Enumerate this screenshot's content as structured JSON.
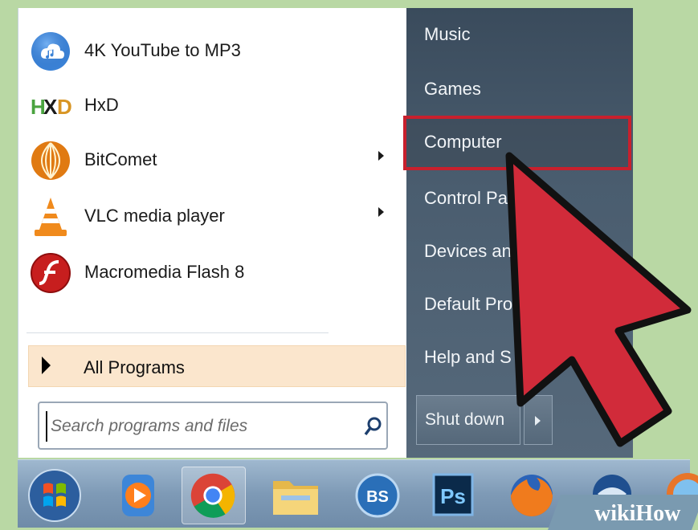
{
  "programs": [
    {
      "label": "4K YouTube to MP3",
      "icon": "4k-youtube-mp3-icon",
      "has_submenu": false
    },
    {
      "label": "HxD",
      "icon": "hxd-icon",
      "has_submenu": false
    },
    {
      "label": "BitComet",
      "icon": "bitcomet-icon",
      "has_submenu": true
    },
    {
      "label": "VLC media player",
      "icon": "vlc-icon",
      "has_submenu": true
    },
    {
      "label": "Macromedia Flash 8",
      "icon": "flash-icon",
      "has_submenu": false
    }
  ],
  "all_programs": {
    "label": "All Programs"
  },
  "search": {
    "placeholder": "Search programs and files"
  },
  "right_links": [
    {
      "label": "Music"
    },
    {
      "label": "Games"
    },
    {
      "label": "Computer"
    },
    {
      "label": "Control Pa"
    },
    {
      "label": "Devices an"
    },
    {
      "label": "Default Pro"
    },
    {
      "label": "Help and S"
    }
  ],
  "shutdown": {
    "label": "Shut down"
  },
  "taskbar_icons": [
    {
      "name": "start-orb-icon"
    },
    {
      "name": "media-player-icon"
    },
    {
      "name": "chrome-icon"
    },
    {
      "name": "folder-icon"
    },
    {
      "name": "bs-player-icon"
    },
    {
      "name": "photoshop-icon",
      "label": "Ps"
    },
    {
      "name": "firefox-icon"
    },
    {
      "name": "thunderbird-icon"
    },
    {
      "name": "browser-icon"
    }
  ],
  "hxd_logo_text": "HXD",
  "bs_label": "BS",
  "watermark": {
    "wiki": "wiki",
    "how": "How"
  },
  "colors": {
    "highlight": "#c8202d",
    "pointer": "#d12b3a",
    "all_programs_bg": "#fbe6cd"
  }
}
